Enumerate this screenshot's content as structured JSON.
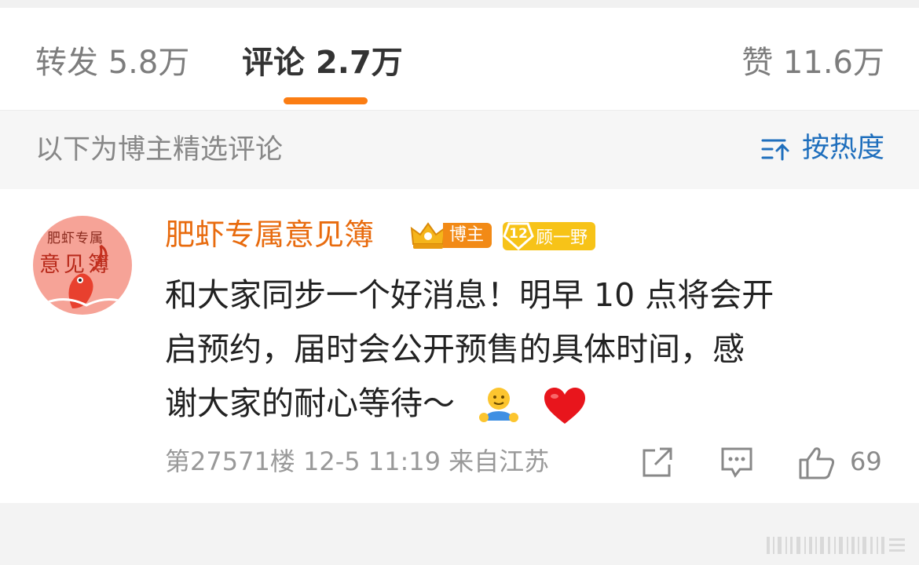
{
  "tabs": {
    "forward_label": "转发 5.8万",
    "comment_label": "评论 2.7万",
    "like_label": "赞 11.6万"
  },
  "filter": {
    "label": "以下为博主精选评论",
    "sort_label": "按热度"
  },
  "comment": {
    "avatar_text_line1": "肥虾专属",
    "avatar_text_line2": "意见簿",
    "username": "肥虾专属意见簿",
    "owner_badge": "博主",
    "fan_level": "12",
    "fan_badge": "顾一野",
    "content_line1": "和大家同步一个好消息！明早 10 点将会开",
    "content_line2": "启预约，届时会公开预售的具体时间，感",
    "content_line3": "谢大家的耐心等待～",
    "meta": "第27571楼 12-5 11:19 来自江苏",
    "like_count": "69"
  },
  "colors": {
    "accent": "#fb7d13",
    "username": "#e86b0e",
    "link": "#1f6fbd",
    "owner_badge": "#f28a16",
    "fan_badge": "#f7c318"
  },
  "icons": [
    "sort-icon",
    "crown-icon",
    "share-icon",
    "comment-icon",
    "thumbs-up-icon",
    "hug-emoji",
    "heart-emoji"
  ]
}
